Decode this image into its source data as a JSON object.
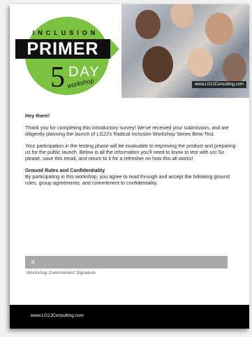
{
  "logo": {
    "inclusion": "INCLUSION",
    "primer": "PRIMER",
    "five": "5",
    "day": "DAY",
    "workshop": "workshop"
  },
  "header": {
    "photo_url": "www.LG2JConsulting.com"
  },
  "body": {
    "greeting": "Hey there!",
    "paragraph1": "Thank you for completing this introductory survey! We've received your submission, and are diligently planning the launch of LG2J's Radical Inclusion Workshop Series Beta-Test.",
    "paragraph2": "Your participation in the testing phase will be invaluable to improving the product and preparing us for the public launch. Below is all the information you'll need to know to test with us! So please, save this email, and return to it for a refresher on how this all works!",
    "rules_title": "Ground Rules and Confidentiality",
    "rules_text": "By participating in this workshop, you agree to read through and accept the following ground rules, group agreements, and commitment to confidentiality."
  },
  "signature": {
    "value": "X",
    "caption": "Workshop Commitment Signature"
  },
  "footer": {
    "url": "www.LG2JConsulting.com"
  },
  "colors": {
    "brand_green": "#7cc142",
    "footer_bg": "#000000",
    "signature_bar": "#a8a8a8"
  }
}
